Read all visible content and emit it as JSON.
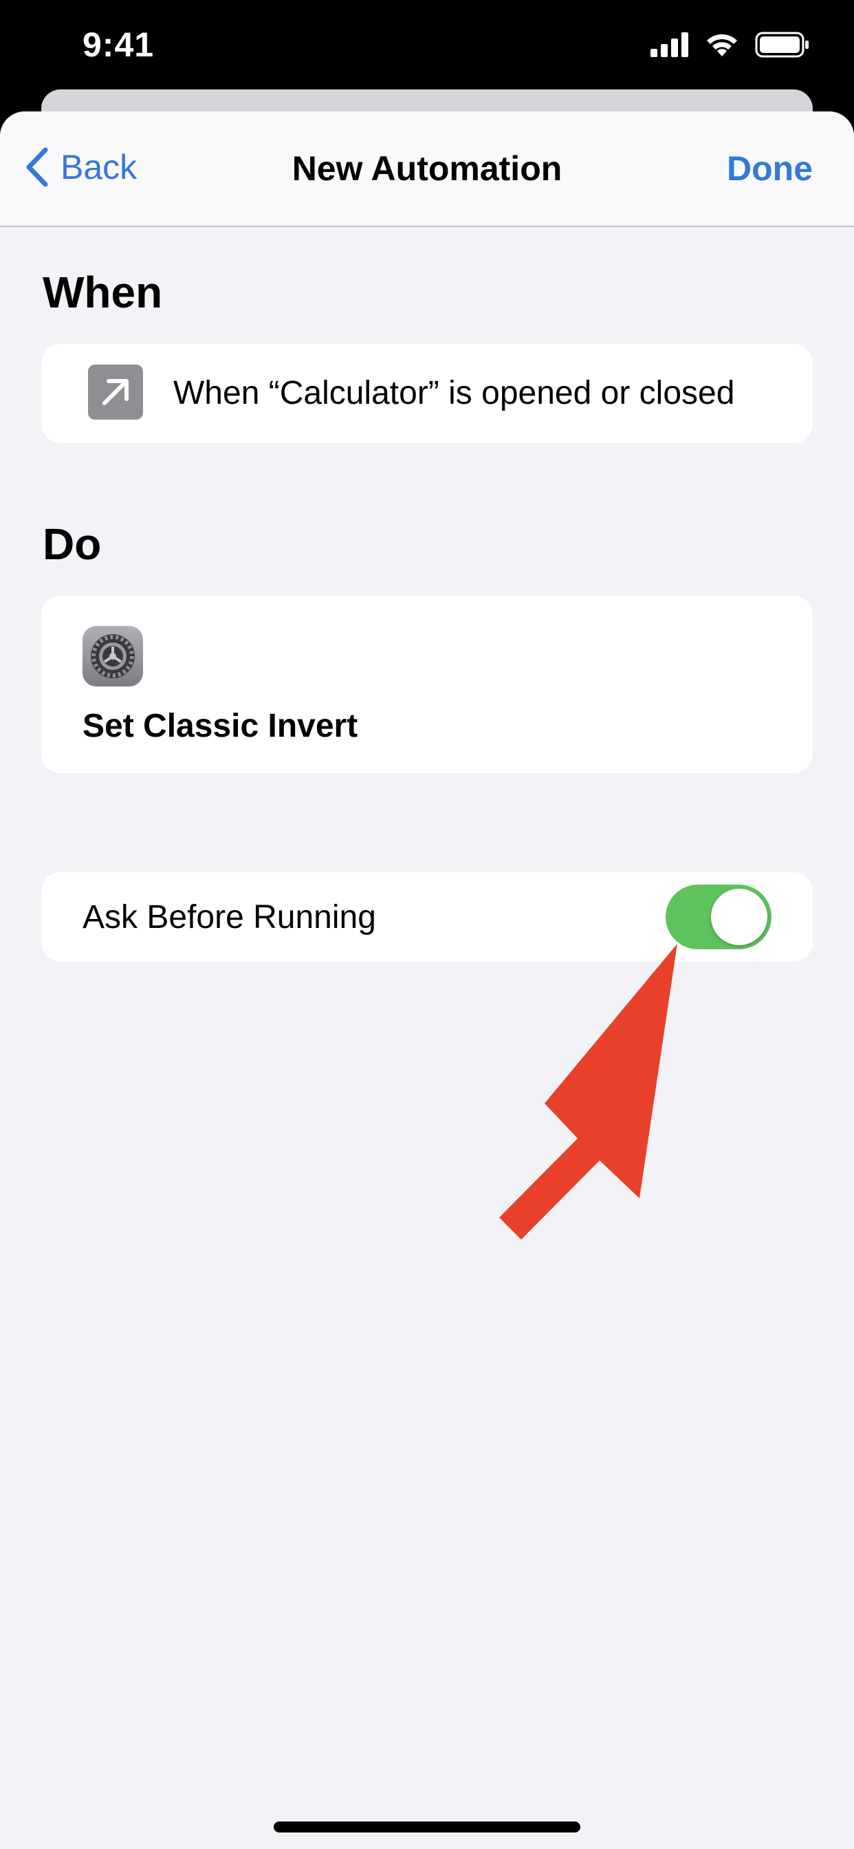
{
  "status_bar": {
    "time": "9:41",
    "icons": [
      "signal-icon",
      "wifi-icon",
      "battery-icon"
    ]
  },
  "nav": {
    "back_label": "Back",
    "title": "New Automation",
    "done_label": "Done"
  },
  "when_section": {
    "heading": "When",
    "trigger_text": "When “Calculator” is opened or closed",
    "icon": "arrow-up-right-icon"
  },
  "do_section": {
    "heading": "Do",
    "action_text": "Set Classic Invert",
    "icon": "settings-gear-icon"
  },
  "ask_before_running": {
    "label": "Ask Before Running",
    "enabled": true
  },
  "colors": {
    "accent": "#3478d8",
    "toggle_on": "#5fc35d",
    "annotation_arrow": "#e8412b",
    "background": "#f2f2f7"
  }
}
